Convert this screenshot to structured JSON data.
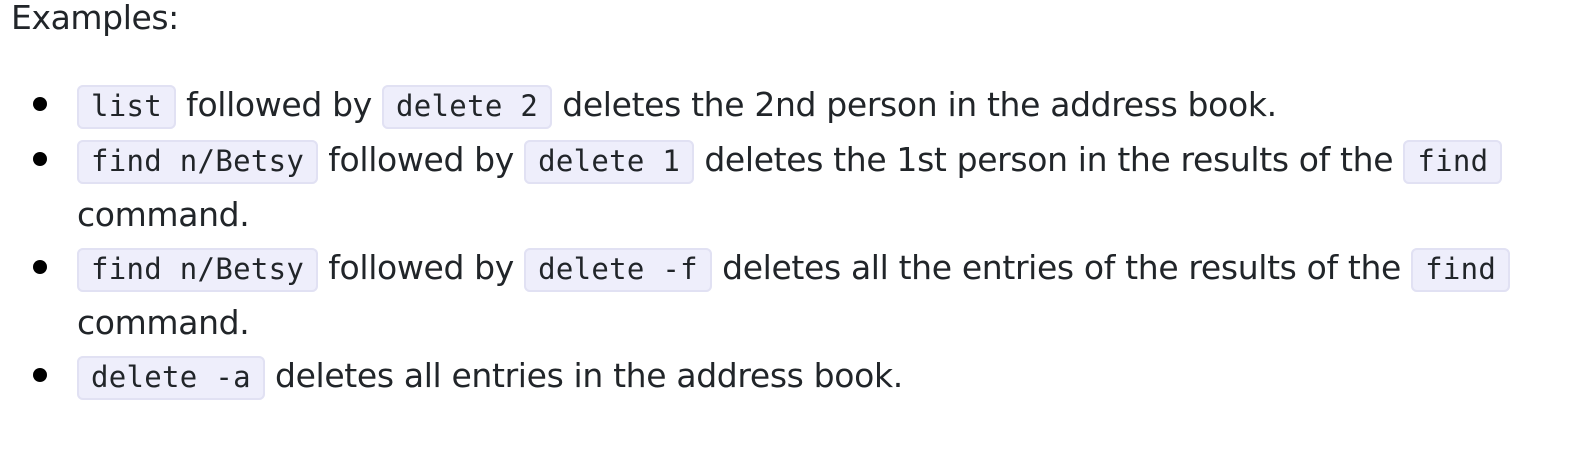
{
  "heading": "Examples:",
  "examples": [
    {
      "cmd1": "list",
      "text1": " followed by ",
      "cmd2": "delete 2",
      "text2": " deletes the 2nd person in the address book."
    },
    {
      "cmd1": "find n/Betsy",
      "text1": " followed by ",
      "cmd2": "delete 1",
      "text2": " deletes the 1st person in the results of the ",
      "cmd3": "find",
      "text3": " command."
    },
    {
      "cmd1": "find n/Betsy",
      "text1": " followed by ",
      "cmd2": "delete -f",
      "text2": " deletes all the entries of the results of the ",
      "cmd3": "find",
      "text3": " command."
    },
    {
      "cmd1": "delete -a",
      "text1": " deletes all entries in the address book."
    }
  ]
}
